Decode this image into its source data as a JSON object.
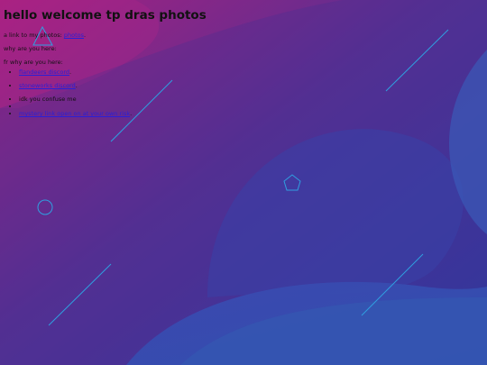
{
  "page": {
    "title": "hello welcome tp dras photos",
    "photos_intro": "a link to my photos:",
    "photos_link": "photos",
    "photos_suffix": ".",
    "question": "why are you here:",
    "answer_intro": "fr why are you here:",
    "reasons": [
      {
        "text": "flandeers discord",
        "suffix": ".",
        "is_link": true
      },
      {
        "text": "stoneworks discord",
        "suffix": ".",
        "is_link": true
      },
      {
        "text": "idk you confuse me",
        "suffix": "",
        "is_link": false
      },
      {
        "text": "",
        "suffix": "",
        "is_link": false
      },
      {
        "text": "mystery link open on at your own risk",
        "suffix": ".",
        "is_link": true
      }
    ]
  },
  "colors": {
    "bg_top_left": "#a8207f",
    "bg_middle": "#3b2f8e",
    "bg_right": "#2f3fa8",
    "wave_fill": "#3a56b0",
    "shape_stroke": "#2f9fe0",
    "link": "#2a1fd6"
  }
}
